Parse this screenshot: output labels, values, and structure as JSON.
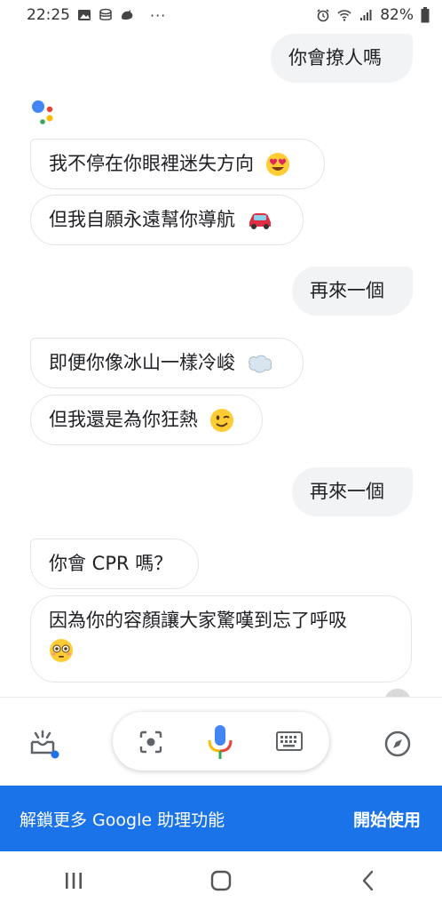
{
  "status_bar": {
    "time": "22:25",
    "battery": "82%",
    "more_dots": "···",
    "left_icons": [
      "gallery-icon",
      "storage-icon",
      "hedgehog-app-icon"
    ],
    "right_icons": [
      "alarm-icon",
      "wifi-icon",
      "signal-icon",
      "battery-icon"
    ]
  },
  "conversation": [
    {
      "role": "user",
      "text": "你會撩人嗎"
    },
    {
      "role": "assistant",
      "text": "我不停在你眼裡迷失方向",
      "emoji": "heart-eyes-emoji"
    },
    {
      "role": "assistant",
      "text": "但我自願永遠幫你導航",
      "emoji": "red-car-emoji"
    },
    {
      "role": "user",
      "text": "再來一個"
    },
    {
      "role": "assistant",
      "text": "即便你像冰山一樣冷峻",
      "emoji": "dash-cloud-emoji"
    },
    {
      "role": "assistant",
      "text": "但我還是為你狂熱",
      "emoji": "wink-emoji"
    },
    {
      "role": "user",
      "text": "再來一個"
    },
    {
      "role": "assistant",
      "text": "你會 CPR 嗎？"
    },
    {
      "role": "assistant",
      "text": "因為你的容顏讓大家驚嘆到忘了呼吸",
      "emoji": "flushed-emoji"
    }
  ],
  "assistant_bar": {
    "left_icon": "updates-tray-icon",
    "lens_icon": "lens-icon",
    "mic_icon": "mic-icon",
    "keyboard_icon": "keyboard-icon",
    "right_icon": "explore-compass-icon"
  },
  "banner": {
    "text": "解鎖更多 Google 助理功能",
    "button": "開始使用",
    "color": "#1a73e8"
  },
  "nav": {
    "items": [
      "recent-apps-icon",
      "home-icon",
      "back-icon"
    ]
  },
  "colors": {
    "user_bubble": "#f1f3f4",
    "google_blue": "#4285f4",
    "google_red": "#ea4335",
    "google_yellow": "#fbbc04",
    "google_green": "#34a853"
  }
}
